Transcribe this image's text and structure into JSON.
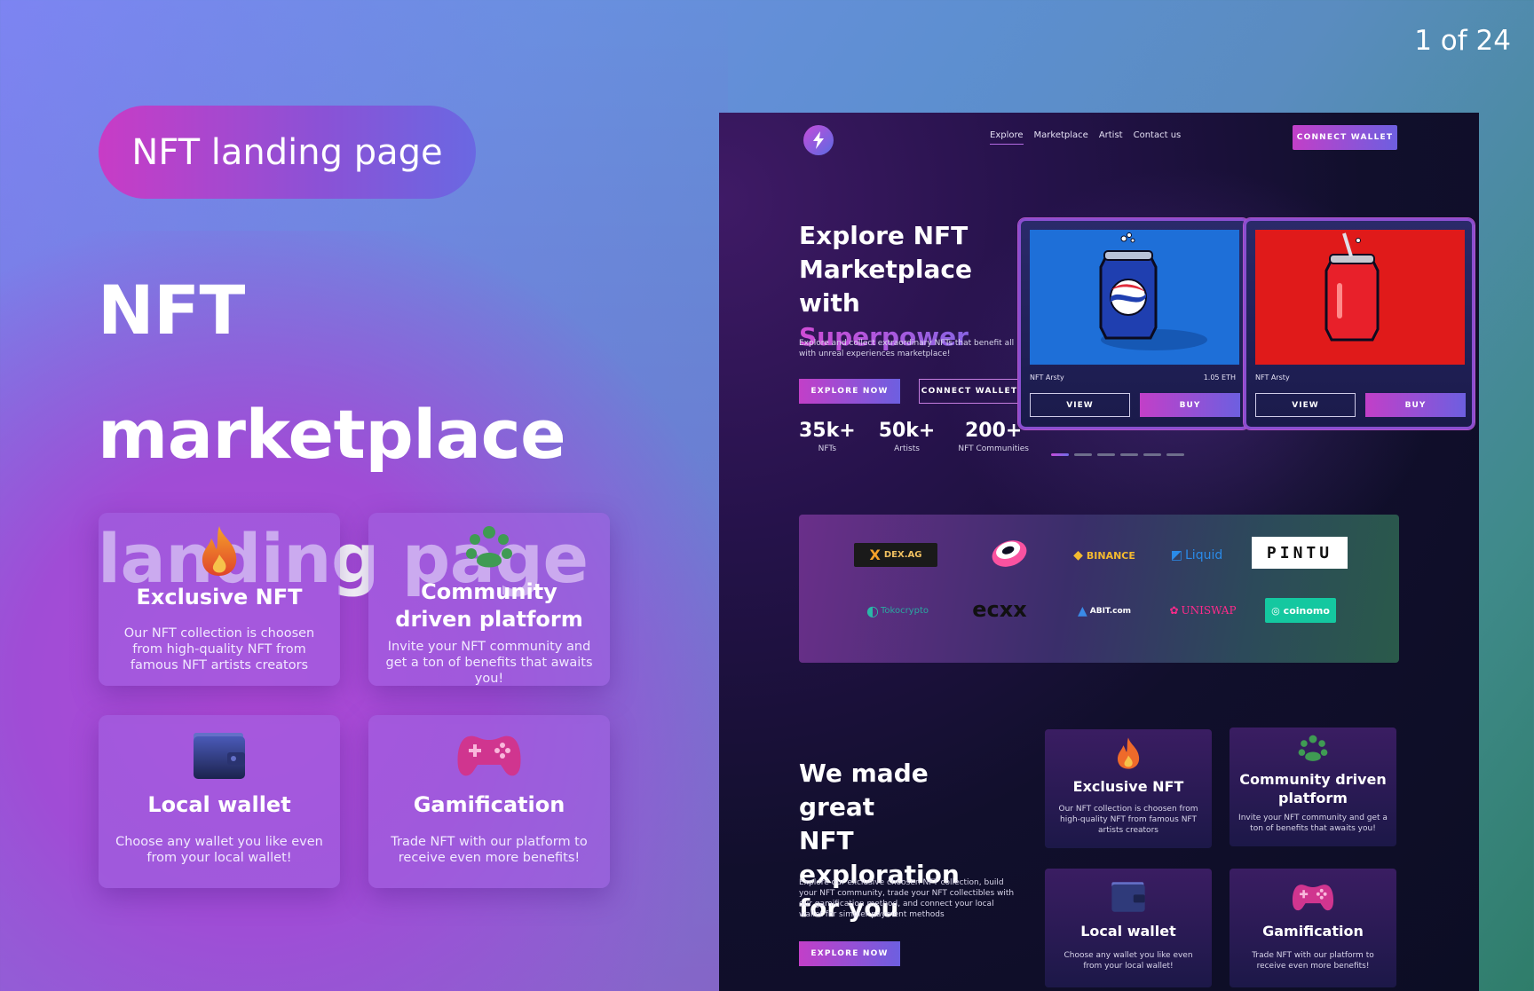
{
  "counter": "1 of 24",
  "pill": "NFT landing page",
  "hero": {
    "line1": "NFT marketplace",
    "line2": "landing page"
  },
  "features": [
    {
      "title": "Exclusive NFT",
      "desc": "Our NFT collection is choosen from high-quality NFT from famous NFT artists creators",
      "icon": "fire-icon"
    },
    {
      "title": "Community driven platform",
      "desc": "Invite your NFT community and get a ton of benefits that awaits you!",
      "icon": "community-icon"
    },
    {
      "title": "Local wallet",
      "desc": "Choose any wallet you like even from your local wallet!",
      "icon": "wallet-icon"
    },
    {
      "title": "Gamification",
      "desc": "Trade NFT with our platform to receive even more benefits!",
      "icon": "gamepad-icon"
    }
  ],
  "mock": {
    "nav": [
      "Explore",
      "Marketplace",
      "Artist",
      "Contact us"
    ],
    "connect_wallet": "CONNECT WALLET",
    "hero_l1": "Explore NFT",
    "hero_l2": "Marketplace with",
    "hero_l3": "Superpower",
    "hero_sub": "Explore and collect extraordinary NFTs that benefit all with unreal experiences marketplace!",
    "explore_now": "EXPLORE NOW",
    "stats": [
      {
        "num": "35k+",
        "label": "NFTs"
      },
      {
        "num": "50k+",
        "label": "Artists"
      },
      {
        "num": "200+",
        "label": "NFT Communities"
      }
    ],
    "nft_cards": [
      {
        "name": "NFT Arsty",
        "price": "1.05 ETH",
        "view": "VIEW",
        "buy": "BUY"
      },
      {
        "name": "NFT Arsty",
        "price": "",
        "view": "VIEW",
        "buy": "BUY"
      }
    ],
    "partners": [
      "DEX.AG",
      "BINANCE",
      "Liquid",
      "PINTU",
      "Tokocrypto",
      "ecxx",
      "ABIT.com",
      "UNISWAP",
      "coinomo"
    ],
    "section_l1": "We made great",
    "section_l2": "NFT exploration",
    "section_l3": "for you",
    "section_sub": "Explore our exclusive choosen NFT collection, build your NFT community, trade your NFT collectibles with our gamification method, and connect your local wallet for simpler payment methods",
    "cards": [
      {
        "title": "Exclusive NFT",
        "desc": "Our NFT collection is choosen from high-quality NFT from famous NFT artists creators"
      },
      {
        "title": "Community driven platform",
        "desc": "Invite your NFT community and get a ton of benefits that awaits you!"
      },
      {
        "title": "Local wallet",
        "desc": "Choose any wallet you like even from your local wallet!"
      },
      {
        "title": "Gamification",
        "desc": "Trade NFT with our platform to receive even more benefits!"
      }
    ]
  },
  "colors": {
    "accent_pink": "#c23fc8",
    "accent_blue": "#6d5fe0",
    "dark_bg": "#0c0d24"
  }
}
